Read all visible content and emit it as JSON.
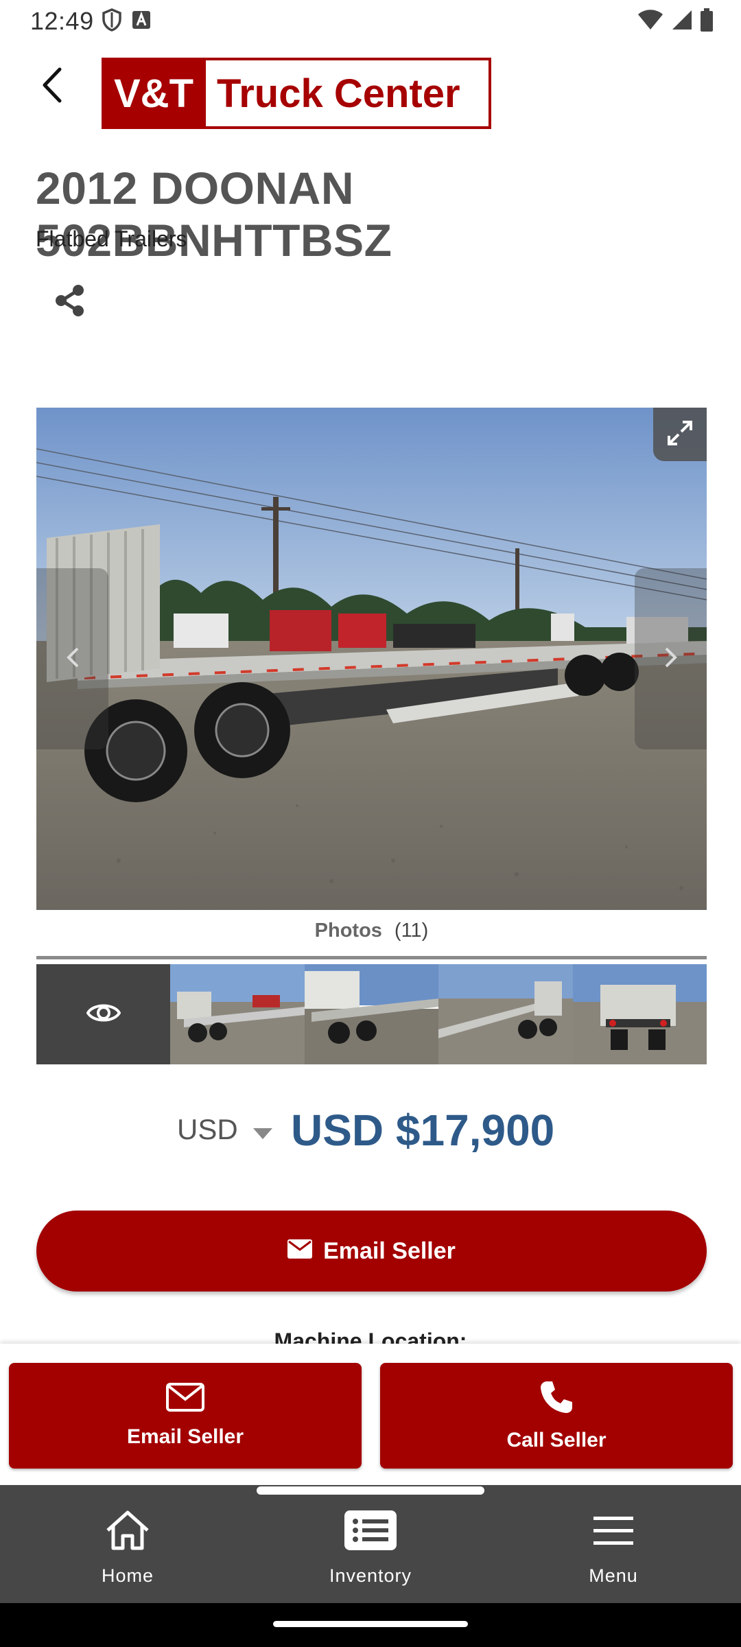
{
  "status_bar": {
    "time": "12:49",
    "icons_left": [
      "shield-icon",
      "font-a-icon"
    ],
    "icons_right": [
      "wifi-icon",
      "signal-icon",
      "battery-icon"
    ]
  },
  "header": {
    "logo_part1": "V&T",
    "logo_part2": "Truck Center",
    "back_icon": "chevron-left-icon"
  },
  "listing": {
    "title": "2012 DOONAN 502BBNHTTBSZ",
    "category": "Flatbed Trailers",
    "share_icon": "share-icon"
  },
  "gallery": {
    "photos_label": "Photos",
    "photos_count": "(11)",
    "expand_icon": "expand-icon",
    "prev_icon": "chevron-left-icon",
    "next_icon": "chevron-right-icon",
    "thumbnail_count": 5
  },
  "price": {
    "currency": "USD",
    "amount": "USD $17,900"
  },
  "actions": {
    "email_seller_main": "Email Seller",
    "machine_location_label": "Machine Location:",
    "contact_email": "Email Seller",
    "contact_call": "Call Seller"
  },
  "bottom_nav": [
    {
      "label": "Home",
      "icon": "home-icon"
    },
    {
      "label": "Inventory",
      "icon": "list-icon"
    },
    {
      "label": "Menu",
      "icon": "hamburger-menu-icon"
    }
  ],
  "colors": {
    "brand_red": "#a30000",
    "price_blue": "#2e5a89",
    "nav_bg": "#474747"
  }
}
